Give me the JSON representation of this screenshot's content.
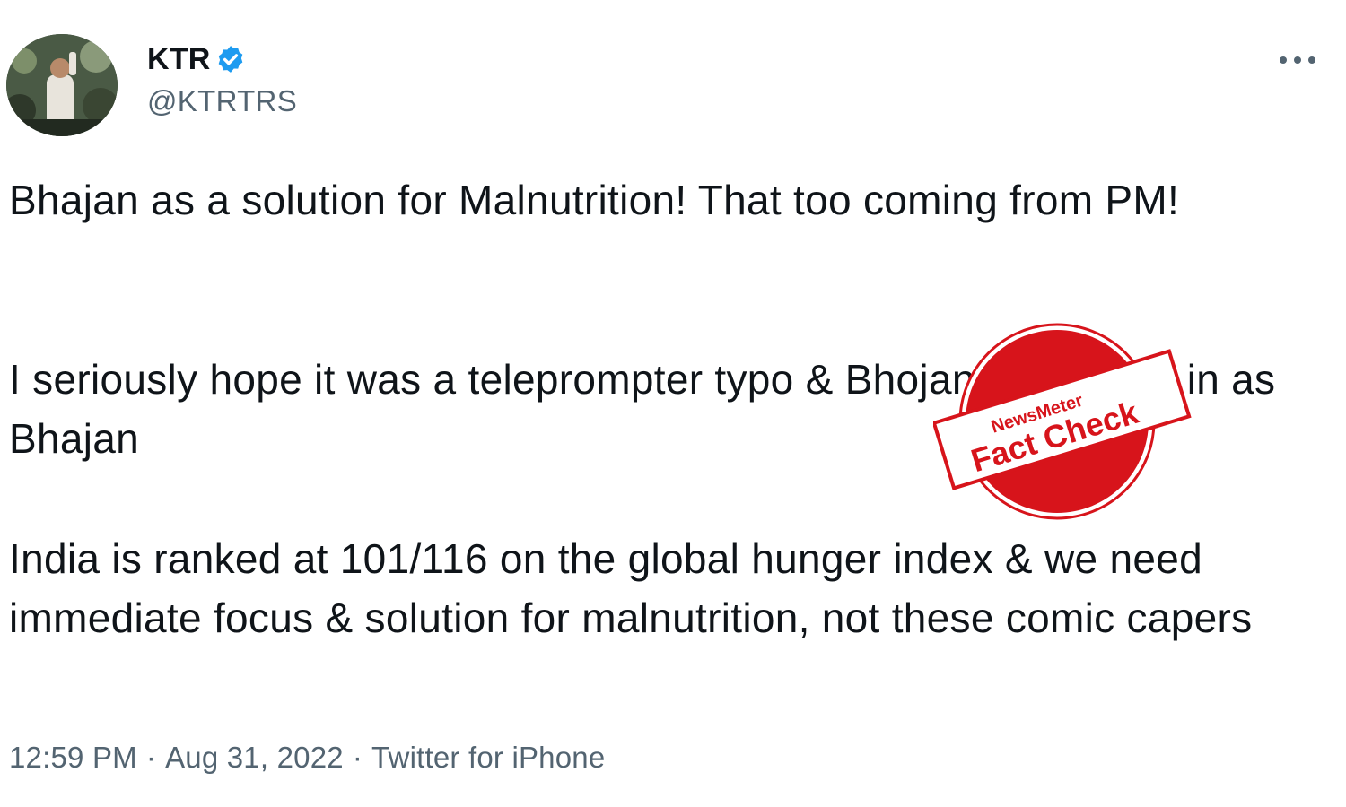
{
  "author": {
    "display_name": "KTR",
    "handle": "@KTRTRS",
    "verified": true,
    "avatar_icon": "profile-photo"
  },
  "menu": {
    "more_icon": "ellipsis-icon"
  },
  "tweet": {
    "paragraphs": [
      "Bhajan as a solution for Malnutrition! That too coming from PM!",
      "I seriously hope it was a teleprompter typo & Bhojan was typed in as Bhajan",
      "India is ranked at 101/116 on the global hunger index & we need immediate focus & solution for malnutrition, not these comic capers"
    ]
  },
  "meta": {
    "time": "12:59 PM",
    "separator": "·",
    "date": "Aug 31, 2022",
    "source": "Twitter for iPhone"
  },
  "stamp": {
    "brand": "NewsMeter",
    "label": "Fact Check",
    "color": "#d7141b"
  },
  "colors": {
    "text": "#0f1419",
    "secondary": "#536471",
    "verified": "#1d9bf0"
  }
}
